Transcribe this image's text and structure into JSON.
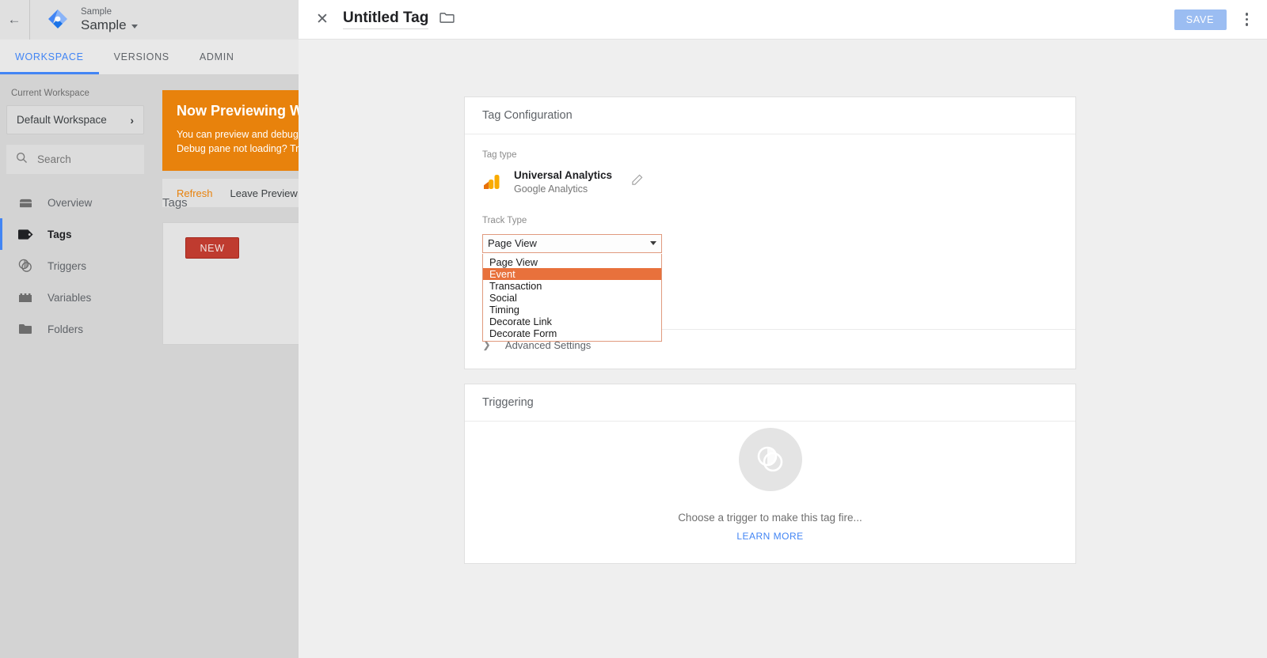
{
  "background": {
    "topbar": {
      "back_icon": "back-arrow-icon",
      "logo_icon": "gtm-logo-icon",
      "account_label": "Sample",
      "container_name": "Sample",
      "caret_icon": "caret-down-icon"
    },
    "tabs": [
      {
        "label": "WORKSPACE",
        "active": true
      },
      {
        "label": "VERSIONS",
        "active": false
      },
      {
        "label": "ADMIN",
        "active": false
      }
    ],
    "sidebar": {
      "current_workspace_label": "Current Workspace",
      "workspace_name": "Default Workspace",
      "workspace_chevron": "chevron-right-icon",
      "search_placeholder": "Search",
      "search_icon": "search-icon",
      "nav": [
        {
          "label": "Overview",
          "icon": "overview-icon",
          "active": false
        },
        {
          "label": "Tags",
          "icon": "tag-icon",
          "active": true
        },
        {
          "label": "Triggers",
          "icon": "trigger-icon",
          "active": false
        },
        {
          "label": "Variables",
          "icon": "variables-icon",
          "active": false
        },
        {
          "label": "Folders",
          "icon": "folder-icon",
          "active": false
        }
      ]
    },
    "preview_banner": {
      "title": "Now Previewing Wor",
      "line1": "You can preview and debug the w",
      "line2": "Debug pane not loading? Try relo",
      "refresh_label": "Refresh",
      "leave_label": "Leave Preview Mod"
    },
    "tags_section": {
      "heading": "Tags",
      "new_button": "NEW"
    }
  },
  "overlay": {
    "header": {
      "close_icon": "close-icon",
      "title": "Untitled Tag",
      "folder_icon": "folder-icon",
      "save_label": "SAVE",
      "more_icon": "kebab-menu-icon"
    },
    "tag_configuration": {
      "card_title": "Tag Configuration",
      "tag_type_label": "Tag type",
      "tag_type_name": "Universal Analytics",
      "tag_type_vendor": "Google Analytics",
      "tag_type_icon": "google-analytics-icon",
      "edit_icon": "pencil-icon",
      "track_type_label": "Track Type",
      "track_type_value": "Page View",
      "dropdown_arrow_icon": "dropdown-arrow-icon",
      "track_type_options": [
        {
          "label": "Page View",
          "selected": false
        },
        {
          "label": "Event",
          "selected": true
        },
        {
          "label": "Transaction",
          "selected": false
        },
        {
          "label": "Social",
          "selected": false
        },
        {
          "label": "Timing",
          "selected": false
        },
        {
          "label": "Decorate Link",
          "selected": false
        },
        {
          "label": "Decorate Form",
          "selected": false
        }
      ],
      "advanced_settings_label": "Advanced Settings",
      "advanced_chevron_icon": "chevron-right-icon"
    },
    "triggering": {
      "card_title": "Triggering",
      "empty_icon": "trigger-circles-icon",
      "empty_text": "Choose a trigger to make this tag fire...",
      "learn_more_label": "LEARN MORE"
    }
  },
  "colors": {
    "accent_blue": "#4285f4",
    "banner_orange": "#e8820c",
    "option_highlight": "#e8713c",
    "select_border": "#e09a7e",
    "new_button_red": "#bf3b2f",
    "save_button_blue": "#9bbdf2"
  }
}
